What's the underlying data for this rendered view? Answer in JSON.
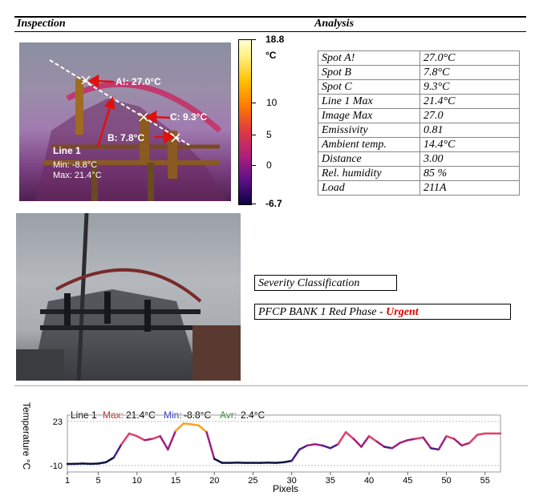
{
  "headers": {
    "inspection": "Inspection",
    "analysis": "Analysis"
  },
  "thermal": {
    "spot_a": "A!: 27.0°C",
    "spot_b": "B: 7.8°C",
    "spot_c": "C: 9.3°C",
    "line_name": "Line 1",
    "line_min": "Min:  -8.8°C",
    "line_max": "Max:  21.4°C",
    "scale": {
      "max": "18.8",
      "unit": "°C",
      "t10": "10",
      "t5": "5",
      "t0": "0",
      "min": "-6.7"
    }
  },
  "analysis_rows": [
    {
      "key": "Spot A!",
      "value": "27.0°C"
    },
    {
      "key": "Spot B",
      "value": "7.8°C"
    },
    {
      "key": "Spot C",
      "value": "9.3°C"
    },
    {
      "key": "Line 1 Max",
      "value": "21.4°C"
    },
    {
      "key": "Image Max",
      "value": "27.0"
    },
    {
      "key": "Emissivity",
      "value": "0.81"
    },
    {
      "key": "Ambient temp.",
      "value": "14.4°C"
    },
    {
      "key": "Distance",
      "value": "3.00"
    },
    {
      "key": "Rel. humidity",
      "value": "85 %"
    },
    {
      "key": "Load",
      "value": "211A"
    }
  ],
  "severity": {
    "label": "Severity Classification",
    "text": "PFCP BANK 1 Red Phase - ",
    "level": "Urgent",
    "level_color": "#e00000"
  },
  "profile": {
    "line_name": "Line 1",
    "max_label": "Max:",
    "max_value": "21.4°C",
    "min_label": "Min:",
    "min_value": "-8.8°C",
    "avr_label": "Avr:",
    "avr_value": "2.4°C",
    "y_label": "Temperature °C",
    "x_label": "Pixels",
    "y_ticks": [
      "23",
      "-10"
    ],
    "x_ticks": [
      "1",
      "5",
      "10",
      "15",
      "20",
      "25",
      "30",
      "35",
      "40",
      "45",
      "50",
      "55"
    ]
  },
  "chart_data": {
    "type": "line",
    "xlabel": "Pixels",
    "ylabel": "Temperature °C",
    "ylim": [
      -10,
      23
    ],
    "x": [
      1,
      2,
      3,
      4,
      5,
      6,
      7,
      8,
      9,
      10,
      11,
      12,
      13,
      14,
      15,
      16,
      17,
      18,
      19,
      20,
      21,
      22,
      23,
      24,
      25,
      26,
      27,
      28,
      29,
      30,
      31,
      32,
      33,
      34,
      35,
      36,
      37,
      38,
      39,
      40,
      41,
      42,
      43,
      44,
      45,
      46,
      47,
      48,
      49,
      50,
      51,
      52,
      53,
      54,
      55,
      56,
      57
    ],
    "series": [
      {
        "name": "Line 1",
        "values": [
          -8.8,
          -8.7,
          -8.5,
          -8.7,
          -8.5,
          -7.5,
          -4,
          6,
          14,
          12,
          9,
          10,
          12,
          2,
          16,
          21.4,
          21,
          20,
          15,
          -5,
          -8,
          -8,
          -7.8,
          -8,
          -8,
          -8,
          -7.8,
          -8,
          -7.5,
          -6.5,
          2,
          5,
          6,
          5,
          3,
          6,
          15,
          10,
          4,
          12,
          8,
          4,
          3,
          7,
          9,
          10,
          11,
          3,
          2,
          12,
          10,
          5,
          7,
          13,
          14,
          14,
          14
        ]
      }
    ]
  }
}
